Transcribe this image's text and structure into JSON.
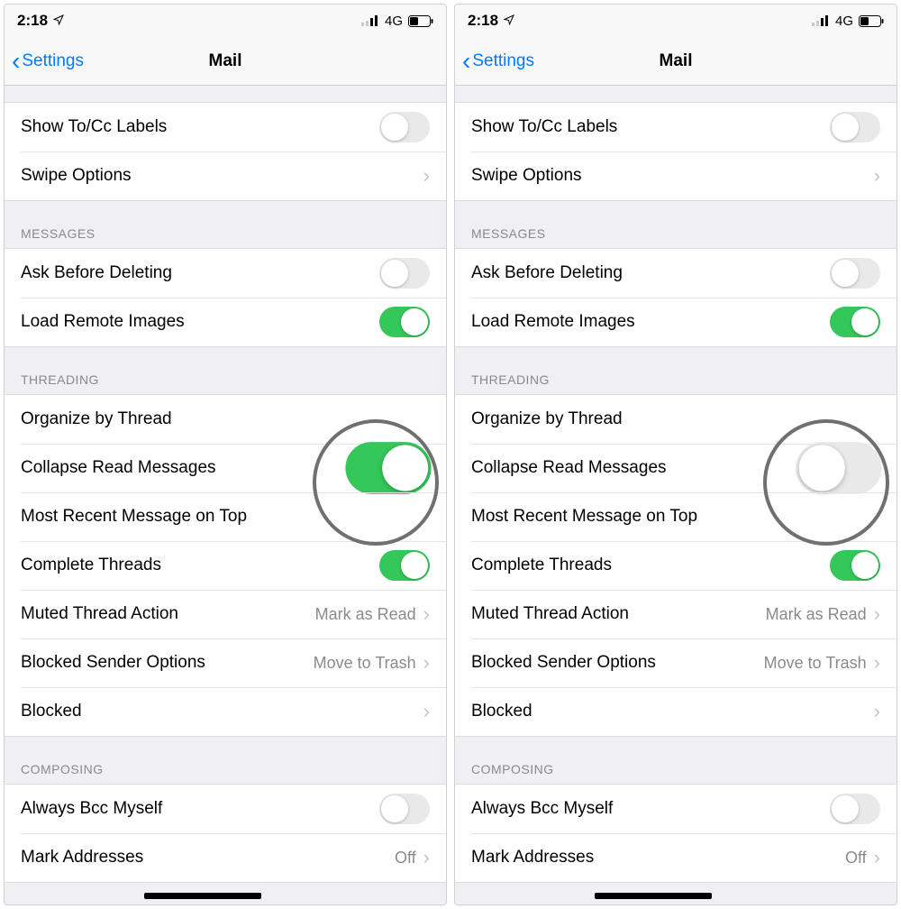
{
  "status": {
    "time": "2:18",
    "network": "4G"
  },
  "nav": {
    "back": "Settings",
    "title": "Mail"
  },
  "labels": {
    "show_tocc": "Show To/Cc Labels",
    "swipe_options": "Swipe Options",
    "ask_before_delete": "Ask Before Deleting",
    "load_remote": "Load Remote Images",
    "organize_thread": "Organize by Thread",
    "collapse_read": "Collapse Read Messages",
    "most_recent_top": "Most Recent Message on Top",
    "complete_threads": "Complete Threads",
    "muted_action": "Muted Thread Action",
    "blocked_sender": "Blocked Sender Options",
    "blocked": "Blocked",
    "always_bcc": "Always Bcc Myself",
    "mark_addresses": "Mark Addresses"
  },
  "values": {
    "muted_action": "Mark as Read",
    "blocked_sender": "Move to Trash",
    "mark_addresses": "Off"
  },
  "headers": {
    "messages": "MESSAGES",
    "threading": "THREADING",
    "composing": "COMPOSING"
  },
  "screens": [
    {
      "toggles": {
        "show_tocc": false,
        "ask_before_delete": false,
        "load_remote": true,
        "collapse_read": true,
        "complete_threads": true,
        "always_bcc": false
      },
      "highlight_on": true
    },
    {
      "toggles": {
        "show_tocc": false,
        "ask_before_delete": false,
        "load_remote": true,
        "collapse_read": false,
        "complete_threads": true,
        "always_bcc": false
      },
      "highlight_on": false
    }
  ]
}
